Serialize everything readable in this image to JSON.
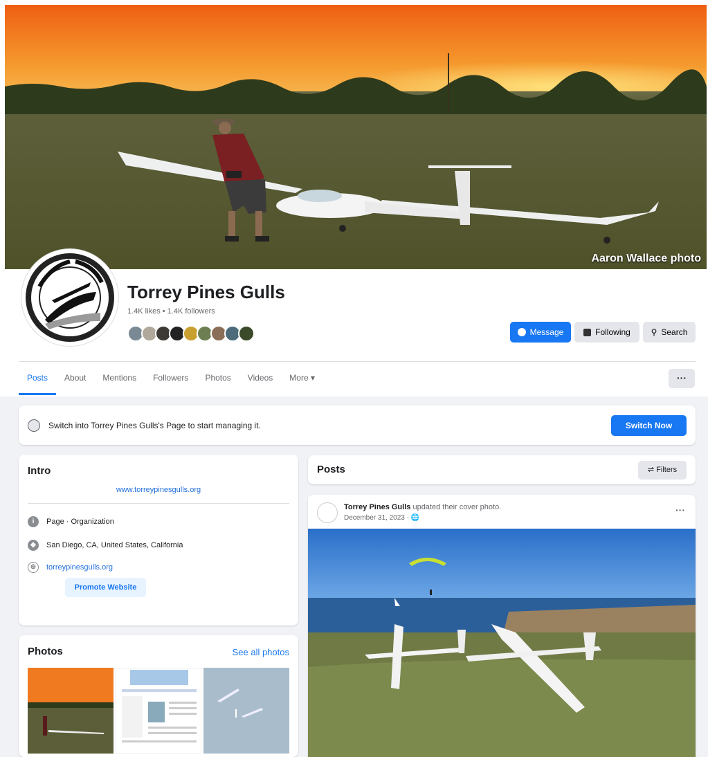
{
  "cover": {
    "credit": "Aaron Wallace photo"
  },
  "page": {
    "name": "Torrey Pines Gulls",
    "stats": "1.4K likes • 1.4K followers"
  },
  "actions": {
    "message": "Message",
    "following": "Following",
    "search": "Search"
  },
  "tabs": [
    "Posts",
    "About",
    "Mentions",
    "Followers",
    "Photos",
    "Videos",
    "More ▾"
  ],
  "switch_banner": {
    "text": "Switch into Torrey Pines Gulls's Page to start managing it.",
    "button": "Switch Now"
  },
  "intro": {
    "title": "Intro",
    "website_text": "www.torreypinesgulls.org",
    "category": "Page · Organization",
    "location": "San Diego, CA, United States, California",
    "website": "torreypinesgulls.org",
    "promote": "Promote Website"
  },
  "photos": {
    "title": "Photos",
    "see_all": "See all photos"
  },
  "posts": {
    "title": "Posts",
    "filters": "Filters",
    "post": {
      "author": "Torrey Pines Gulls",
      "action": "updated their cover photo.",
      "date": "December 31, 2023 · 🌐",
      "more": "···"
    }
  },
  "colors": {
    "accent": "#1877f2",
    "background": "#f0f2f5"
  }
}
